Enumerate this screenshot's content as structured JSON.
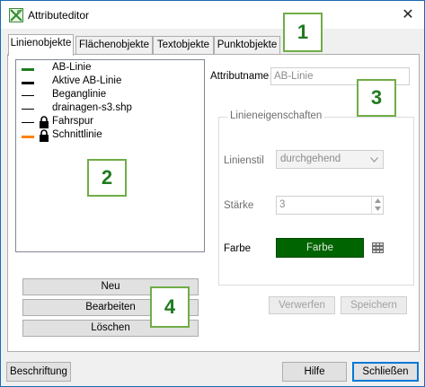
{
  "window": {
    "title": "Attributeditor",
    "close_symbol": "✕"
  },
  "tabs": [
    "Linienobjekte",
    "Flächenobjekte",
    "Textobjekte",
    "Punktobjekte"
  ],
  "layers": [
    {
      "label": "AB-Linie",
      "swatch": "#1e7d1e",
      "locked": false
    },
    {
      "label": "Aktive AB-Linie",
      "swatch": "#000000",
      "locked": false
    },
    {
      "label": "Beganglinie",
      "swatch": "#000000",
      "locked": false
    },
    {
      "label": "drainagen-s3.shp",
      "swatch": "#000000",
      "locked": false
    },
    {
      "label": "Fahrspur",
      "swatch": "#000000",
      "locked": true
    },
    {
      "label": "Schnittlinie",
      "swatch": "#ff8000",
      "locked": true
    }
  ],
  "list_buttons": {
    "new": "Neu",
    "edit": "Bearbeiten",
    "delete": "Löschen"
  },
  "attribute": {
    "name_label": "Attributname",
    "name_value": "AB-Linie"
  },
  "line_props": {
    "group_title": "Linieneigenschaften",
    "style_label": "Linienstil",
    "style_value": "durchgehend",
    "width_label": "Stärke",
    "width_value": "3",
    "color_label": "Farbe",
    "color_button": "Farbe",
    "color_value": "#006400"
  },
  "actions": {
    "discard": "Verwerfen",
    "save": "Speichern"
  },
  "footer": {
    "labeling": "Beschriftung",
    "help": "Hilfe",
    "close": "Schließen"
  },
  "callouts": [
    "1",
    "2",
    "3",
    "4"
  ]
}
